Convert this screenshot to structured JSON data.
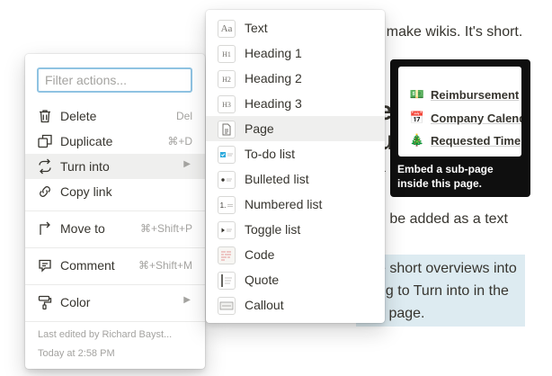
{
  "background": {
    "line1": "to make wikis. It's short.",
    "heading_a": "e",
    "heading_b": "u",
    "line2": "a",
    "line3": "n be added as a text",
    "callout": {
      "line1": "e short overviews into",
      "line2": "ng to Turn into in the",
      "line3": "y page."
    }
  },
  "tooltip": {
    "items": [
      {
        "emoji": "💵",
        "label": "Reimbursement"
      },
      {
        "emoji": "📅",
        "label": "Company Calend"
      },
      {
        "emoji": "🎄",
        "label": "Requested Time"
      }
    ],
    "caption": "Embed a sub-page inside this page."
  },
  "action_menu": {
    "filter": {
      "placeholder": "Filter actions...",
      "value": ""
    },
    "items": [
      {
        "label": "Delete",
        "shortcut": "Del",
        "icon": "trash-icon"
      },
      {
        "label": "Duplicate",
        "shortcut": "⌘+D",
        "icon": "duplicate-icon"
      },
      {
        "label": "Turn into",
        "shortcut": "",
        "icon": "turn-into-icon",
        "submenu": true
      },
      {
        "label": "Copy link",
        "shortcut": "",
        "icon": "link-icon"
      },
      {
        "label": "Move to",
        "shortcut": "⌘+Shift+P",
        "icon": "move-to-icon"
      },
      {
        "label": "Comment",
        "shortcut": "⌘+Shift+M",
        "icon": "comment-icon"
      },
      {
        "label": "Color",
        "shortcut": "",
        "icon": "paint-roller-icon",
        "submenu": true
      }
    ],
    "footer": {
      "edited_by": "Last edited by Richard Bayst...",
      "edited_at": "Today at 2:58 PM"
    }
  },
  "turn_into_menu": {
    "items": [
      {
        "label": "Text",
        "icon": "text-block-icon",
        "glyph": "Aa"
      },
      {
        "label": "Heading 1",
        "icon": "heading-1-icon",
        "glyph": "H1"
      },
      {
        "label": "Heading 2",
        "icon": "heading-2-icon",
        "glyph": "H2"
      },
      {
        "label": "Heading 3",
        "icon": "heading-3-icon",
        "glyph": "H3"
      },
      {
        "label": "Page",
        "icon": "page-icon",
        "glyph": ""
      },
      {
        "label": "To-do list",
        "icon": "todo-list-icon",
        "glyph": ""
      },
      {
        "label": "Bulleted list",
        "icon": "bulleted-list-icon",
        "glyph": ""
      },
      {
        "label": "Numbered list",
        "icon": "numbered-list-icon",
        "glyph": "1."
      },
      {
        "label": "Toggle list",
        "icon": "toggle-list-icon",
        "glyph": ""
      },
      {
        "label": "Code",
        "icon": "code-block-icon",
        "glyph": ""
      },
      {
        "label": "Quote",
        "icon": "quote-block-icon",
        "glyph": ""
      },
      {
        "label": "Callout",
        "icon": "callout-block-icon",
        "glyph": ""
      }
    ],
    "active_label": "Page"
  },
  "colors": {
    "menu_hover": "#efefee",
    "input_focus": "#8fc3e2",
    "callout_bg": "#ddebf1",
    "tooltip_bg": "#0f0f0f",
    "muted_text": "#a4a3a0"
  }
}
